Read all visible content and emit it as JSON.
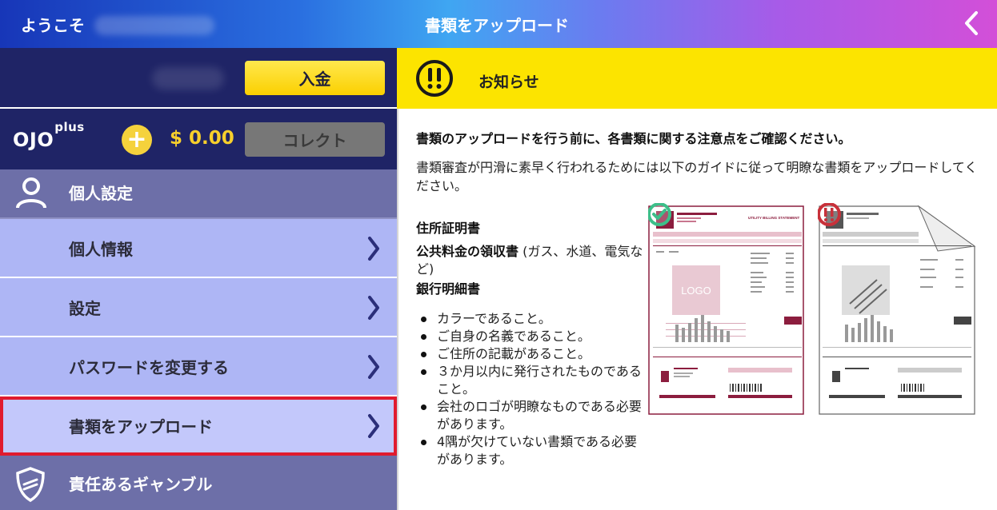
{
  "header": {
    "welcome": "ようこそ",
    "title": "書類をアップロード",
    "back_icon": "chevron-left-icon"
  },
  "account": {
    "deposit_label": "入金"
  },
  "ojo": {
    "logo_main": "OJO",
    "logo_sup": "plus",
    "amount": "$ 0.00",
    "collect_label": "コレクト"
  },
  "menu": {
    "section_label": "個人設定",
    "items": [
      {
        "label": "個人情報"
      },
      {
        "label": "設定"
      },
      {
        "label": "パスワードを変更する"
      },
      {
        "label": "書類をアップロード"
      }
    ],
    "footer_label": "責任あるギャンブル"
  },
  "notice": {
    "title": "お知らせ"
  },
  "content": {
    "intro_bold": "書類のアップロードを行う前に、各書類に関する注意点をご確認ください。",
    "intro": "書類審査が円滑に素早く行われるためには以下のガイドに従って明瞭な書類をアップロードしてください。",
    "doc_title": "住所証明書",
    "doc_line_bold": "公共料金の領収書",
    "doc_line_rest": " (ガス、水道、電気など)",
    "doc_line2": "銀行明細書",
    "bullets": [
      "カラーであること。",
      "ご自身の名義であること。",
      "ご住所の記載があること。",
      "３か月以内に発行されたものであること。",
      "会社のロゴが明瞭なものである必要があります。",
      "4隅が欠けていない書類である必要があります。"
    ],
    "sample_good": {
      "logo_text": "LOGO",
      "heading": "UTILITY BILLING STATEMENT"
    },
    "colors": {
      "accent_yellow": "#fce400",
      "menu_blue": "#aeb6f5",
      "highlight_red": "#e01b2e",
      "good_green": "#3dbf8a",
      "bad_red": "#c8313a",
      "doc_maroon": "#8c1d3e"
    }
  }
}
